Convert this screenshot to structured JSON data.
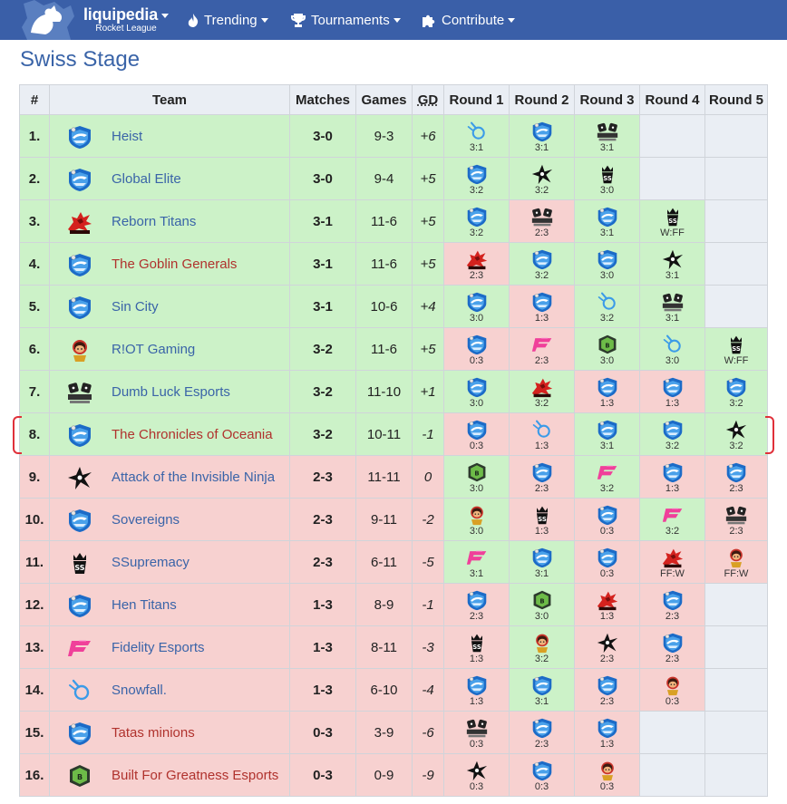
{
  "nav": {
    "brand": "liquipedia",
    "brand_sub": "Rocket League",
    "items": [
      "Trending",
      "Tournaments",
      "Contribute"
    ]
  },
  "page_title": "Swiss Stage",
  "table": {
    "headers": [
      "#",
      "Team",
      "Matches",
      "Games",
      "GD",
      "Round 1",
      "Round 2",
      "Round 3",
      "Round 4",
      "Round 5"
    ],
    "rows": [
      {
        "pos": "1.",
        "team": "Heist",
        "logo": "rl",
        "color": "blue",
        "matches": "3-0",
        "games": "9-3",
        "gd": "+6",
        "row": "pos",
        "rounds": [
          {
            "logo": "snow",
            "score": "3:1",
            "r": "w"
          },
          {
            "logo": "rl",
            "score": "3:1",
            "r": "w"
          },
          {
            "logo": "dl",
            "score": "3:1",
            "r": "w"
          },
          {
            "logo": "",
            "score": "",
            "r": "e"
          },
          {
            "logo": "",
            "score": "",
            "r": "e"
          }
        ]
      },
      {
        "pos": "2.",
        "team": "Global Elite",
        "logo": "rl",
        "color": "blue",
        "matches": "3-0",
        "games": "9-4",
        "gd": "+5",
        "row": "pos",
        "rounds": [
          {
            "logo": "rl",
            "score": "3:2",
            "r": "w"
          },
          {
            "logo": "ninja",
            "score": "3:2",
            "r": "w"
          },
          {
            "logo": "ss",
            "score": "3:0",
            "r": "w"
          },
          {
            "logo": "",
            "score": "",
            "r": "e"
          },
          {
            "logo": "",
            "score": "",
            "r": "e"
          }
        ]
      },
      {
        "pos": "3.",
        "team": "Reborn Titans",
        "logo": "reborn",
        "color": "blue",
        "matches": "3-1",
        "games": "11-6",
        "gd": "+5",
        "row": "pos",
        "rounds": [
          {
            "logo": "rl",
            "score": "3:2",
            "r": "w"
          },
          {
            "logo": "dl",
            "score": "2:3",
            "r": "l"
          },
          {
            "logo": "rl",
            "score": "3:1",
            "r": "w"
          },
          {
            "logo": "ss",
            "score": "W:FF",
            "r": "w"
          },
          {
            "logo": "",
            "score": "",
            "r": "e"
          }
        ]
      },
      {
        "pos": "4.",
        "team": "The Goblin Generals",
        "logo": "rl",
        "color": "red",
        "matches": "3-1",
        "games": "11-6",
        "gd": "+5",
        "row": "pos",
        "rounds": [
          {
            "logo": "reborn",
            "score": "2:3",
            "r": "l"
          },
          {
            "logo": "rl",
            "score": "3:2",
            "r": "w"
          },
          {
            "logo": "rl",
            "score": "3:0",
            "r": "w"
          },
          {
            "logo": "ninja",
            "score": "3:1",
            "r": "w"
          },
          {
            "logo": "",
            "score": "",
            "r": "e"
          }
        ]
      },
      {
        "pos": "5.",
        "team": "Sin City",
        "logo": "rl",
        "color": "blue",
        "matches": "3-1",
        "games": "10-6",
        "gd": "+4",
        "row": "pos",
        "rounds": [
          {
            "logo": "rl",
            "score": "3:0",
            "r": "w"
          },
          {
            "logo": "rl",
            "score": "1:3",
            "r": "l"
          },
          {
            "logo": "snow",
            "score": "3:2",
            "r": "w"
          },
          {
            "logo": "dl",
            "score": "3:1",
            "r": "w"
          },
          {
            "logo": "",
            "score": "",
            "r": "e"
          }
        ]
      },
      {
        "pos": "6.",
        "team": "R!OT Gaming",
        "logo": "riot",
        "color": "blue",
        "matches": "3-2",
        "games": "11-6",
        "gd": "+5",
        "row": "pos",
        "rounds": [
          {
            "logo": "rl",
            "score": "0:3",
            "r": "l"
          },
          {
            "logo": "fid",
            "score": "2:3",
            "r": "l"
          },
          {
            "logo": "bfg",
            "score": "3:0",
            "r": "w"
          },
          {
            "logo": "snow",
            "score": "3:0",
            "r": "w"
          },
          {
            "logo": "ss",
            "score": "W:FF",
            "r": "w"
          }
        ]
      },
      {
        "pos": "7.",
        "team": "Dumb Luck Esports",
        "logo": "dl",
        "color": "blue",
        "matches": "3-2",
        "games": "11-10",
        "gd": "+1",
        "row": "pos",
        "rounds": [
          {
            "logo": "rl",
            "score": "3:0",
            "r": "w"
          },
          {
            "logo": "reborn",
            "score": "3:2",
            "r": "w"
          },
          {
            "logo": "rl",
            "score": "1:3",
            "r": "l"
          },
          {
            "logo": "rl",
            "score": "1:3",
            "r": "l"
          },
          {
            "logo": "rl",
            "score": "3:2",
            "r": "w"
          }
        ]
      },
      {
        "pos": "8.",
        "team": "The Chronicles of Oceania",
        "logo": "rl",
        "color": "red",
        "matches": "3-2",
        "games": "10-11",
        "gd": "-1",
        "row": "pos",
        "rounds": [
          {
            "logo": "rl",
            "score": "0:3",
            "r": "l"
          },
          {
            "logo": "snow",
            "score": "1:3",
            "r": "l"
          },
          {
            "logo": "rl",
            "score": "3:1",
            "r": "w"
          },
          {
            "logo": "rl",
            "score": "3:2",
            "r": "w"
          },
          {
            "logo": "ninja",
            "score": "3:2",
            "r": "w"
          }
        ]
      },
      {
        "pos": "9.",
        "team": "Attack of the Invisible Ninja",
        "logo": "ninja",
        "color": "blue",
        "matches": "2-3",
        "games": "11-11",
        "gd": "0",
        "row": "neg",
        "rounds": [
          {
            "logo": "bfg",
            "score": "3:0",
            "r": "w"
          },
          {
            "logo": "rl",
            "score": "2:3",
            "r": "l"
          },
          {
            "logo": "fid",
            "score": "3:2",
            "r": "w"
          },
          {
            "logo": "rl",
            "score": "1:3",
            "r": "l"
          },
          {
            "logo": "rl",
            "score": "2:3",
            "r": "l"
          }
        ]
      },
      {
        "pos": "10.",
        "team": "Sovereigns",
        "logo": "rl",
        "color": "blue",
        "matches": "2-3",
        "games": "9-11",
        "gd": "-2",
        "row": "neg",
        "rounds": [
          {
            "logo": "riot",
            "score": "3:0",
            "r": "w"
          },
          {
            "logo": "ss",
            "score": "1:3",
            "r": "l"
          },
          {
            "logo": "rl",
            "score": "0:3",
            "r": "l"
          },
          {
            "logo": "fid",
            "score": "3:2",
            "r": "w"
          },
          {
            "logo": "dl",
            "score": "2:3",
            "r": "l"
          }
        ]
      },
      {
        "pos": "11.",
        "team": "SSupremacy",
        "logo": "ss",
        "color": "blue",
        "matches": "2-3",
        "games": "6-11",
        "gd": "-5",
        "row": "neg",
        "rounds": [
          {
            "logo": "fid",
            "score": "3:1",
            "r": "w"
          },
          {
            "logo": "rl",
            "score": "3:1",
            "r": "w"
          },
          {
            "logo": "rl",
            "score": "0:3",
            "r": "l"
          },
          {
            "logo": "reborn",
            "score": "FF:W",
            "r": "l"
          },
          {
            "logo": "riot",
            "score": "FF:W",
            "r": "l"
          }
        ]
      },
      {
        "pos": "12.",
        "team": "Hen Titans",
        "logo": "rl",
        "color": "blue",
        "matches": "1-3",
        "games": "8-9",
        "gd": "-1",
        "row": "neg",
        "rounds": [
          {
            "logo": "rl",
            "score": "2:3",
            "r": "l"
          },
          {
            "logo": "bfg",
            "score": "3:0",
            "r": "w"
          },
          {
            "logo": "reborn",
            "score": "1:3",
            "r": "l"
          },
          {
            "logo": "rl",
            "score": "2:3",
            "r": "l"
          },
          {
            "logo": "",
            "score": "",
            "r": "e"
          }
        ]
      },
      {
        "pos": "13.",
        "team": "Fidelity Esports",
        "logo": "fid",
        "color": "blue",
        "matches": "1-3",
        "games": "8-11",
        "gd": "-3",
        "row": "neg",
        "rounds": [
          {
            "logo": "ss",
            "score": "1:3",
            "r": "l"
          },
          {
            "logo": "riot",
            "score": "3:2",
            "r": "w"
          },
          {
            "logo": "ninja",
            "score": "2:3",
            "r": "l"
          },
          {
            "logo": "rl",
            "score": "2:3",
            "r": "l"
          },
          {
            "logo": "",
            "score": "",
            "r": "e"
          }
        ]
      },
      {
        "pos": "14.",
        "team": "Snowfall.",
        "logo": "snow",
        "color": "blue",
        "matches": "1-3",
        "games": "6-10",
        "gd": "-4",
        "row": "neg",
        "rounds": [
          {
            "logo": "rl",
            "score": "1:3",
            "r": "l"
          },
          {
            "logo": "rl",
            "score": "3:1",
            "r": "w"
          },
          {
            "logo": "rl",
            "score": "2:3",
            "r": "l"
          },
          {
            "logo": "riot",
            "score": "0:3",
            "r": "l"
          },
          {
            "logo": "",
            "score": "",
            "r": "e"
          }
        ]
      },
      {
        "pos": "15.",
        "team": "Tatas minions",
        "logo": "rl",
        "color": "red",
        "matches": "0-3",
        "games": "3-9",
        "gd": "-6",
        "row": "neg",
        "rounds": [
          {
            "logo": "dl",
            "score": "0:3",
            "r": "l"
          },
          {
            "logo": "rl",
            "score": "2:3",
            "r": "l"
          },
          {
            "logo": "rl",
            "score": "1:3",
            "r": "l"
          },
          {
            "logo": "",
            "score": "",
            "r": "e"
          },
          {
            "logo": "",
            "score": "",
            "r": "e"
          }
        ]
      },
      {
        "pos": "16.",
        "team": "Built For Greatness Esports",
        "logo": "bfg",
        "color": "red",
        "matches": "0-3",
        "games": "0-9",
        "gd": "-9",
        "row": "neg",
        "rounds": [
          {
            "logo": "ninja",
            "score": "0:3",
            "r": "l"
          },
          {
            "logo": "rl",
            "score": "0:3",
            "r": "l"
          },
          {
            "logo": "riot",
            "score": "0:3",
            "r": "l"
          },
          {
            "logo": "",
            "score": "",
            "r": "e"
          },
          {
            "logo": "",
            "score": "",
            "r": "e"
          }
        ]
      }
    ]
  },
  "highlight_row": "8."
}
